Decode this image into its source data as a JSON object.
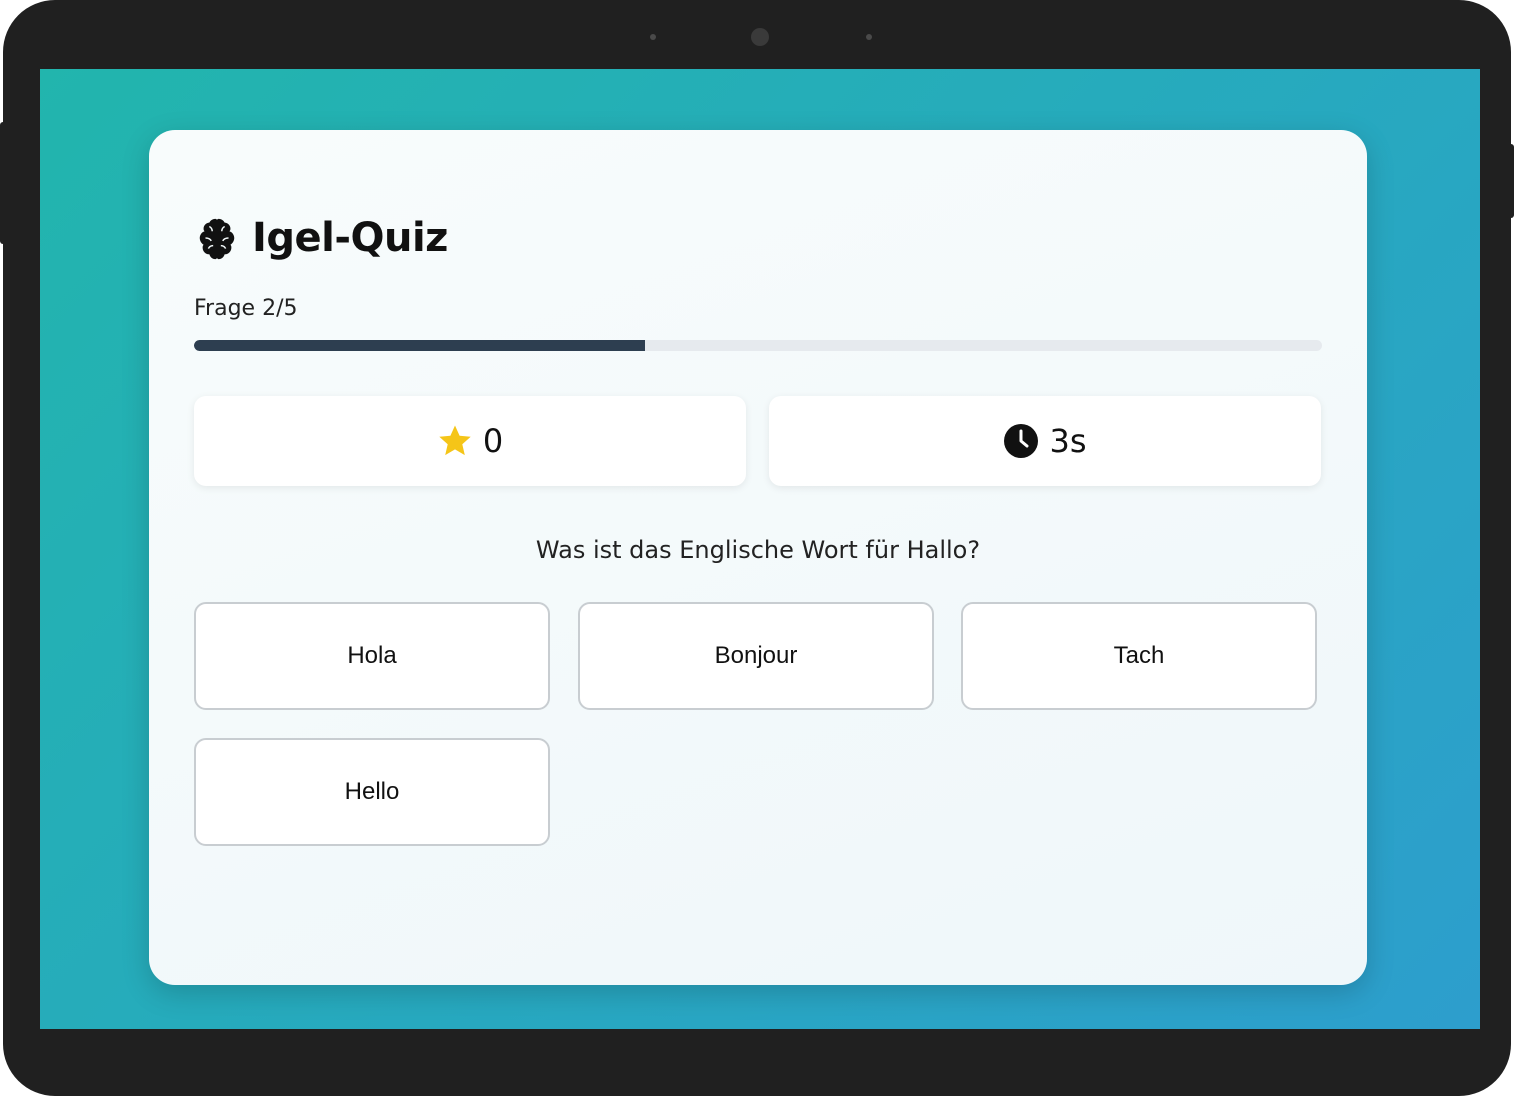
{
  "app": {
    "title": "Igel-Quiz",
    "title_icon": "brain-icon"
  },
  "progress": {
    "label": "Frage 2/5",
    "fraction": 0.4
  },
  "stats": {
    "score": {
      "icon": "star-icon",
      "value": "0",
      "color": "#f5c518"
    },
    "timer": {
      "icon": "clock-icon",
      "value": "3s"
    }
  },
  "question": {
    "text": "Was ist das Englische Wort für Hallo?"
  },
  "answers": [
    {
      "label": "Hola"
    },
    {
      "label": "Bonjour"
    },
    {
      "label": "Tach"
    },
    {
      "label": "Hello"
    }
  ],
  "colors": {
    "background_gradient_start": "#22b5ad",
    "background_gradient_end": "#2d9ecd",
    "progress_fill": "#2d3e50",
    "progress_track": "#e6eaee",
    "device_frame": "#202020"
  }
}
